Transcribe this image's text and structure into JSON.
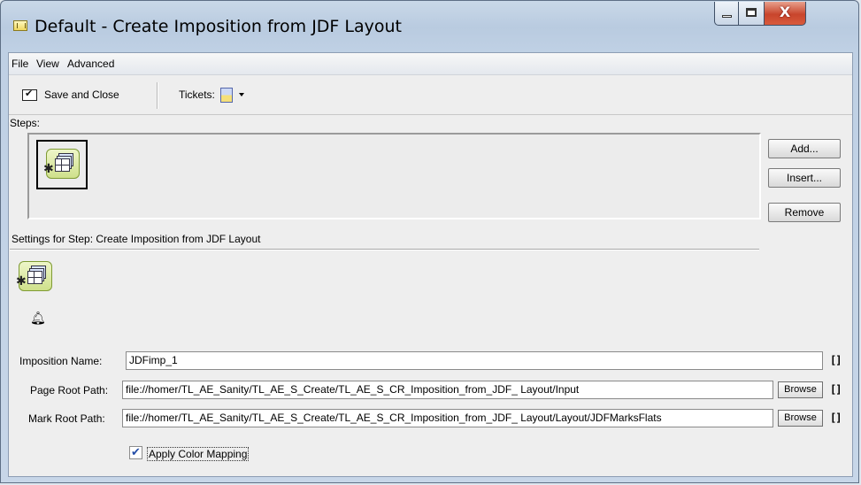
{
  "window": {
    "title": "Default - Create Imposition from JDF Layout"
  },
  "menu": [
    "File",
    "View",
    "Advanced"
  ],
  "toolbar": {
    "save_close": "Save and Close",
    "tickets": "Tickets:"
  },
  "steps": {
    "label": "Steps:",
    "items": [
      {
        "icon": "imposition-step-icon",
        "selected": true
      }
    ]
  },
  "buttons": {
    "add": "Add...",
    "insert": "Insert...",
    "remove": "Remove"
  },
  "settings": {
    "label": "Settings for Step: Create Imposition from JDF Layout"
  },
  "fields": {
    "imposition_name": {
      "label": "Imposition Name:",
      "value": "JDFimp_1"
    },
    "page_root": {
      "label": "Page Root Path:",
      "value": "file://homer/TL_AE_Sanity/TL_AE_S_Create/TL_AE_S_CR_Imposition_from_JDF_ Layout/Input"
    },
    "mark_root": {
      "label": "Mark Root Path:",
      "value": "file://homer/TL_AE_Sanity/TL_AE_S_Create/TL_AE_S_CR_Imposition_from_JDF_ Layout/Layout/JDFMarksFlats"
    },
    "browse": "Browse",
    "bracket": "[]"
  },
  "apply_color_mapping": {
    "label": "Apply Color Mapping",
    "checked": true
  }
}
